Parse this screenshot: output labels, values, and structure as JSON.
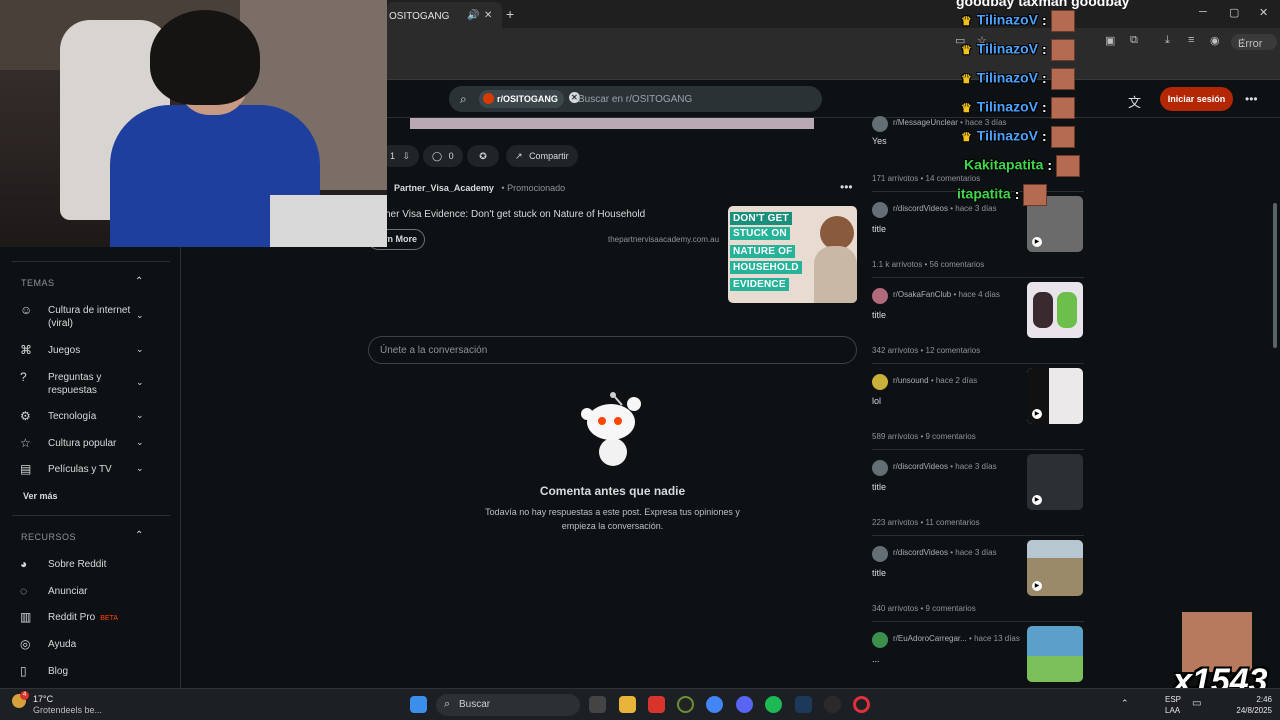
{
  "browser": {
    "tab_title": "OSITOGANG",
    "new_tab": "+",
    "error_label": "Error"
  },
  "header": {
    "search_chip": "r/OSITOGANG",
    "search_placeholder": "Buscar en r/OSITOGANG",
    "login_label": "Iniciar sesión"
  },
  "sidebar": {
    "temas_label": "TEMAS",
    "temas_items": [
      {
        "label": "Cultura de internet (viral)",
        "icon": "smiley-icon"
      },
      {
        "label": "Juegos",
        "icon": "gamepad-icon"
      },
      {
        "label": "Preguntas y respuestas",
        "icon": "question-icon"
      },
      {
        "label": "Tecnología",
        "icon": "tech-icon"
      },
      {
        "label": "Cultura popular",
        "icon": "star-icon"
      },
      {
        "label": "Películas y TV",
        "icon": "film-icon"
      }
    ],
    "ver_mas": "Ver más",
    "recursos_label": "RECURSOS",
    "recursos_items": [
      {
        "label": "Sobre Reddit",
        "icon": "reddit-icon"
      },
      {
        "label": "Anunciar",
        "icon": "megaphone-icon"
      },
      {
        "label": "Reddit Pro",
        "icon": "chart-icon",
        "badge": "BETA"
      },
      {
        "label": "Ayuda",
        "icon": "help-icon"
      },
      {
        "label": "Blog",
        "icon": "book-icon"
      }
    ]
  },
  "post": {
    "vote_count": "1",
    "comment_count": "0",
    "share_label": "Compartir"
  },
  "ad": {
    "user": "Partner_Visa_Academy",
    "promo": "Promocionado",
    "title": "her Visa Evidence: Don't get stuck on Nature of Household",
    "button": "arn More",
    "domain": "thepartnervisaacademy.com.au",
    "thumb_lines": [
      "DON'T GET",
      "STUCK ON",
      "NATURE OF",
      "HOUSEHOLD",
      "EVIDENCE"
    ]
  },
  "comments": {
    "placeholder": "Únete a la conversación",
    "empty_title": "Comenta antes que nadie",
    "empty_sub": "Todavía no hay respuestas a este post. Expresa tus opiniones y empieza la conversación."
  },
  "feed": [
    {
      "sub": "r/MessageUnclear",
      "age": "hace 3 días",
      "title": "Yes",
      "votes": "171 arrivotos",
      "comments": "14 comentarios",
      "thumb_color": "#2b2b2b"
    },
    {
      "sub": "r/discordVideos",
      "age": "hace 3 días",
      "title": "title",
      "votes": "1.1 k arrivotos",
      "comments": "56 comentarios",
      "thumb_color": "#6b6b6b"
    },
    {
      "sub": "r/OsakaFanClub",
      "age": "hace 4 días",
      "title": "title",
      "votes": "342 arrivotos",
      "comments": "12 comentarios",
      "thumb_color": "#e9e4ea"
    },
    {
      "sub": "r/unsound",
      "age": "hace 2 días",
      "title": "lol",
      "votes": "589 arrivotos",
      "comments": "9 comentarios",
      "thumb_color": "#ece9ea"
    },
    {
      "sub": "r/discordVideos",
      "age": "hace 3 días",
      "title": "title",
      "votes": "223 arrivotos",
      "comments": "11 comentarios",
      "thumb_color": "#2c3034"
    },
    {
      "sub": "r/discordVideos",
      "age": "hace 3 días",
      "title": "title",
      "votes": "340 arrivotos",
      "comments": "9 comentarios",
      "thumb_color": "#9a8a6a"
    },
    {
      "sub": "r/EuAdoroCarregar...",
      "age": "hace 13 días",
      "title": "...",
      "votes": "",
      "comments": "",
      "thumb_color": "#5aa0c8"
    }
  ],
  "chat": {
    "top_line": "goodbay taxman goodbay",
    "lines": [
      {
        "user": "TilinazoV",
        "crown": true,
        "color": "blue"
      },
      {
        "user": "TilinazoV",
        "crown": true,
        "color": "blue"
      },
      {
        "user": "TilinazoV",
        "crown": true,
        "color": "blue"
      },
      {
        "user": "TilinazoV",
        "crown": true,
        "color": "blue"
      },
      {
        "user": "TilinazoV",
        "crown": true,
        "color": "blue"
      },
      {
        "user": "Kakitapatita",
        "crown": false,
        "color": "green"
      },
      {
        "user": "itapatita",
        "crown": false,
        "color": "green"
      }
    ],
    "counter": "x1543"
  },
  "taskbar": {
    "temp": "17°C",
    "weather_desc": "Grotendeels be...",
    "weather_badge": "4",
    "search_label": "Buscar",
    "lang": "ESP",
    "lang2": "LAA",
    "time": "2:46",
    "date": "24/8/2025"
  }
}
